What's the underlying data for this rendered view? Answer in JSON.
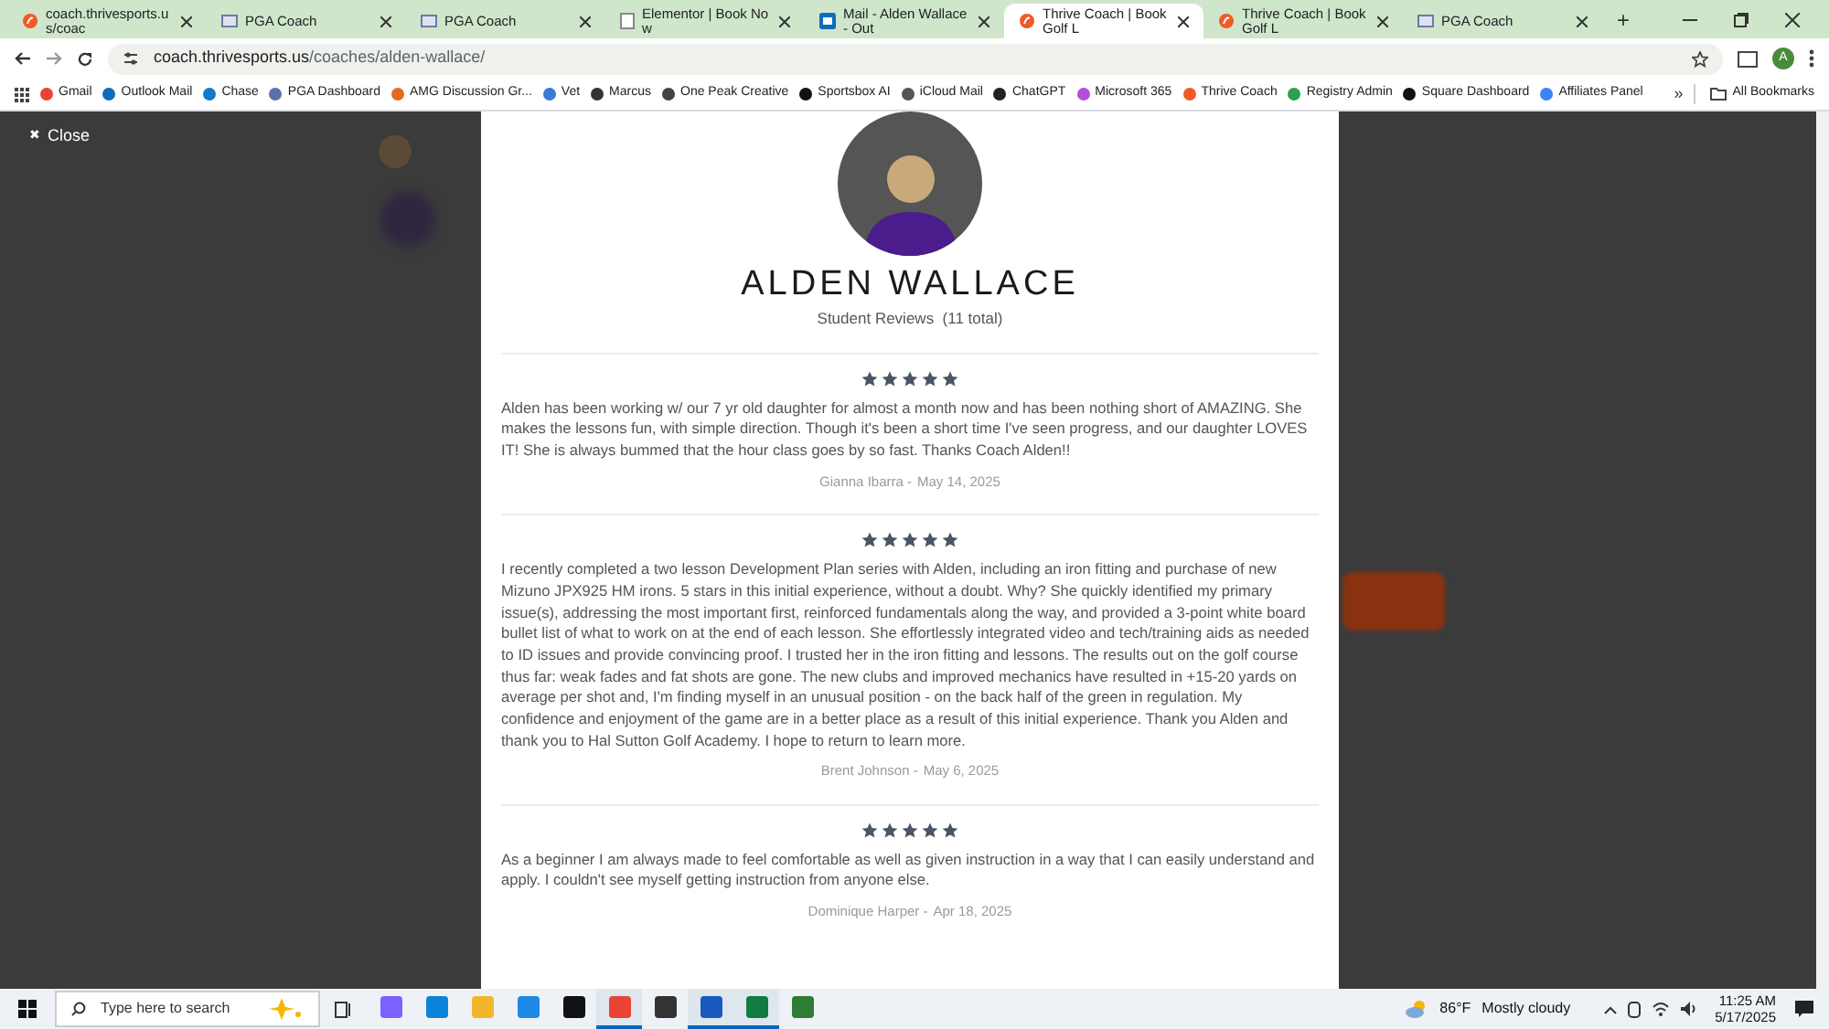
{
  "tabs": [
    {
      "title": "coach.thrivesports.us/coac",
      "kind": "thrive",
      "selected": false
    },
    {
      "title": "PGA Coach",
      "kind": "pga",
      "selected": false
    },
    {
      "title": "PGA Coach",
      "kind": "pga",
      "selected": false
    },
    {
      "title": "Elementor | Book Now",
      "kind": "doc",
      "selected": false
    },
    {
      "title": "Mail - Alden Wallace - Out",
      "kind": "mail",
      "selected": false
    },
    {
      "title": "Thrive Coach | Book Golf L",
      "kind": "thrive",
      "selected": true
    },
    {
      "title": "Thrive Coach | Book Golf L",
      "kind": "thrive",
      "selected": false
    },
    {
      "title": "PGA Coach",
      "kind": "pga",
      "selected": false
    }
  ],
  "new_tab": "+",
  "address": {
    "host": "coach.thrivesports.us",
    "path": "/coaches/alden-wallace/"
  },
  "profile_initial": "A",
  "bookmarks": [
    {
      "label": "Gmail",
      "color": "#ea4335"
    },
    {
      "label": "Outlook Mail",
      "color": "#0f6cbd"
    },
    {
      "label": "Chase",
      "color": "#117aca"
    },
    {
      "label": "PGA Dashboard",
      "color": "#5b6fa8"
    },
    {
      "label": "AMG Discussion Gr...",
      "color": "#e36b1f"
    },
    {
      "label": "Vet",
      "color": "#3a7bd5"
    },
    {
      "label": "Marcus",
      "color": "#333333"
    },
    {
      "label": "One Peak Creative",
      "color": "#444444"
    },
    {
      "label": "Sportsbox AI",
      "color": "#111111"
    },
    {
      "label": "iCloud Mail",
      "color": "#555555"
    },
    {
      "label": "ChatGPT",
      "color": "#222222"
    },
    {
      "label": "Microsoft 365",
      "color": "#b34ddb"
    },
    {
      "label": "Thrive Coach",
      "color": "#f05a28"
    },
    {
      "label": "Registry Admin",
      "color": "#2e9e4f"
    },
    {
      "label": "Square Dashboard",
      "color": "#111111"
    },
    {
      "label": "Affiliates Panel",
      "color": "#3b82f6"
    }
  ],
  "bookmarks_more": "»",
  "all_bookmarks": "All Bookmarks",
  "close": {
    "icon": "✖",
    "label": "Close"
  },
  "coach": {
    "name": "ALDEN WALLACE",
    "subtitle": "Student Reviews  (11 total)"
  },
  "reviews": [
    {
      "stars": 5,
      "text": "Alden has been working w/ our 7 yr old daughter for almost a month now and has been nothing short of AMAZING. She makes the lessons fun, with simple direction. Though it's been a short time I've seen progress, and our daughter LOVES IT! She is always bummed that the hour class goes by so fast. Thanks Coach Alden!!",
      "author": "Gianna Ibarra -",
      "date": "May 14, 2025"
    },
    {
      "stars": 5,
      "text": "I recently completed a two lesson Development Plan series with Alden, including an iron fitting and purchase of new Mizuno JPX925 HM irons. 5 stars in this initial experience, without a doubt. Why? She quickly identified my primary issue(s), addressing the most important first, reinforced fundamentals along the way, and provided a 3-point white board bullet list of what to work on at the end of each lesson. She effortlessly integrated video and tech/training aids as needed to ID issues and provide convincing proof. I trusted her in the iron fitting and lessons. The results out on the golf course thus far: weak fades and fat shots are gone. The new clubs and improved mechanics have resulted in +15-20 yards on average per shot and, I'm finding myself in an unusual position - on the back half of the green in regulation. My confidence and enjoyment of the game are in a better place as a result of this initial experience. Thank you Alden and thank you to Hal Sutton Golf Academy. I hope to return to learn more.",
      "author": "Brent Johnson -",
      "date": "May 6, 2025"
    },
    {
      "stars": 5,
      "text": "As a beginner I am always made to feel comfortable as well as given instruction in a way that I can easily understand and apply. I couldn't see myself getting instruction from anyone else.",
      "author": "Dominique Harper -",
      "date": "Apr 18, 2025"
    }
  ],
  "taskbar": {
    "search_placeholder": "Type here to search",
    "apps": [
      {
        "color": "#7b61ff",
        "selected": false
      },
      {
        "color": "#0a84d8",
        "selected": false
      },
      {
        "color": "#f2b62b",
        "selected": false
      },
      {
        "color": "#1e88e5",
        "selected": false
      },
      {
        "color": "#111111",
        "selected": false
      },
      {
        "color": "#ea4335",
        "selected": true
      },
      {
        "color": "#333333",
        "selected": false
      },
      {
        "color": "#185abd",
        "selected": true
      },
      {
        "color": "#107c41",
        "selected": true
      },
      {
        "color": "#2e7d32",
        "selected": false
      }
    ],
    "weather": {
      "temp": "86°F",
      "condition": "Mostly cloudy"
    },
    "time": "11:25 AM",
    "date": "5/17/2025"
  }
}
